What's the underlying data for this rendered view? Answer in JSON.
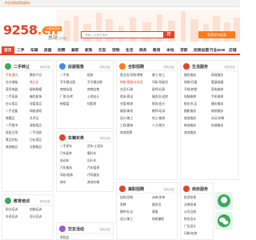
{
  "topbar": {
    "links": "供应采购|网络建站"
  },
  "header": {
    "logo_main": "9258",
    "logo_tld": ".cn",
    "logo_sub": "分类信息网",
    "city": "总站",
    "city_switch": "[切换]",
    "search_placeholder": "请输入关键字搜索",
    "search_button": "搜",
    "post_button": "免费发布信息"
  },
  "nav": {
    "items": [
      "首页",
      "二手",
      "车辆",
      "房屋",
      "招聘",
      "兼职",
      "家政",
      "交友",
      "宠物",
      "生活",
      "商务",
      "教育",
      "本地",
      "求职",
      "招商加盟",
      "行业B2B",
      "店铺"
    ]
  },
  "colors": {
    "brand": "#e5432b",
    "accent": "#ff7b1a",
    "green": "#3aaa5a",
    "blue": "#3d8ee8",
    "purple": "#9b59d0"
  },
  "panels": {
    "ershou": {
      "title": "二手转让",
      "more": "发布信息",
      "icon": "house-icon",
      "links": [
        "手机通讯",
        "数码产品",
        "台式电脑",
        "笔记本",
        "家用电器",
        "服装鞋帽",
        "二手家具",
        "箱包配饰",
        "办公用品",
        "母婴用品",
        "二手设备",
        "网络游戏",
        "收藏品",
        "艺术品",
        "二手图书",
        "宠物用品",
        "家居日用",
        "二手回收",
        "食品饮料",
        "日化用品",
        "其他物品",
        "交换物品"
      ]
    },
    "house": {
      "title": "房屋租售",
      "more": "发布信息",
      "icon": "home-icon",
      "links": [
        "二手房",
        "租房",
        "写字楼出租",
        "写字楼出售",
        "商铺出租",
        "商铺出售",
        "厂房/仓库",
        "土地出让",
        "新楼盘",
        "短租房"
      ]
    },
    "jobs": {
      "title": "全职招聘",
      "more": "发布信息",
      "icon": "briefcase-icon",
      "links": [
        "营业员/导购/零售",
        "普工/技工",
        "销售/客服/业务员",
        "司机/驾驶员",
        "文员/行政",
        "厨师/后厨",
        "保安/保洁",
        "服务员/迎宾",
        "仓管/物流",
        "财务/会计",
        "美容/美发",
        "教师/培训",
        "设计/美工",
        "电工/维修",
        "工程/建筑",
        "人力/猎头",
        "其他招聘"
      ]
    },
    "life": {
      "title": "生活服务",
      "more": "发布信息",
      "icon": "service-icon",
      "links": [
        "搬家服务",
        "家政服务",
        "保姆/月嫂",
        "管道疏通",
        "开锁/修锁",
        "家电维修",
        "电脑维修",
        "手机维修",
        "鲜花/礼品",
        "婚庆服务",
        "摄影服务",
        "装修服务",
        "旅游服务",
        "办证/刻章",
        "物流服务",
        "快递服务",
        "其他服务"
      ]
    },
    "cars": {
      "title": "车辆买卖",
      "more": "发布信息",
      "icon": "car-icon",
      "links": [
        "二手轿车",
        "货车/工程车",
        "汽车配件",
        "摩托车",
        "电动车",
        "自行车",
        "汽车服务",
        "汽车租赁",
        "驾校/陪练",
        "代驾服务",
        "新车",
        "其他车辆"
      ]
    },
    "parttime": {
      "title": "兼职招聘",
      "more": "发布信息",
      "icon": "parttime-icon",
      "links": [
        "促销/导购",
        "派单/发单",
        "家教",
        "服务员",
        "模特/礼仪",
        "客服",
        "设计/美工",
        "网络兼职"
      ]
    },
    "business": {
      "title": "商务服务",
      "more": "发布信息",
      "icon": "business-icon",
      "links": [
        "投资担保",
        "法律咨询",
        "公司注册",
        "财务会计",
        "广告设计",
        "印刷/包装",
        "网站建设",
        "翻译服务"
      ]
    },
    "edu": {
      "title": "教育培训",
      "more": "发布信息",
      "icon": "edu-icon",
      "links": [
        "职业培训",
        "电脑培训",
        "外语培训",
        "设计培训"
      ]
    },
    "dating": {
      "title": "交友活动",
      "more": "发布信息",
      "icon": "heart-icon",
      "links": [
        "男找女"
      ]
    }
  }
}
